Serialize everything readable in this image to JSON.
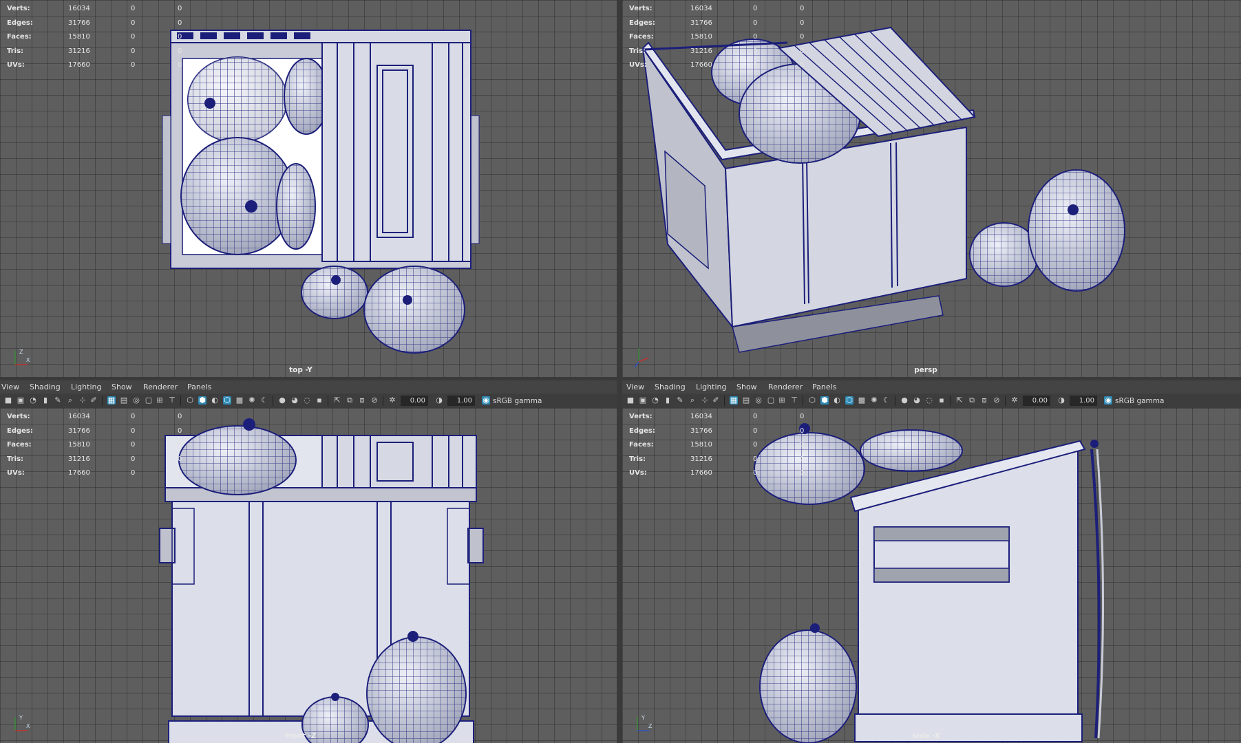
{
  "hud": {
    "rows": [
      {
        "label": "Verts:",
        "value": "16034",
        "sel": "0",
        "comp": "0"
      },
      {
        "label": "Edges:",
        "value": "31766",
        "sel": "0",
        "comp": "0"
      },
      {
        "label": "Faces:",
        "value": "15810",
        "sel": "0",
        "comp": "0"
      },
      {
        "label": "Tris:",
        "value": "31216",
        "sel": "0",
        "comp": "0"
      },
      {
        "label": "UVs:",
        "value": "17660",
        "sel": "0",
        "comp": "0"
      }
    ]
  },
  "viewports": {
    "top": {
      "camera": "top -Y"
    },
    "persp": {
      "camera": "persp"
    },
    "front": {
      "camera": "front -Z"
    },
    "side": {
      "camera": "side -X"
    }
  },
  "menu": {
    "items": [
      "View",
      "Shading",
      "Lighting",
      "Show",
      "Renderer",
      "Panels"
    ]
  },
  "toolbar": {
    "exposure": "0.00",
    "gamma": "1.00",
    "color_space": "sRGB gamma"
  },
  "colors": {
    "wire": "#1c1f7a",
    "surface": "#dcdfe9",
    "surface_dark": "#a9adb9",
    "grid_bg": "#5e5e5e",
    "accent": "#2f8bb5"
  }
}
